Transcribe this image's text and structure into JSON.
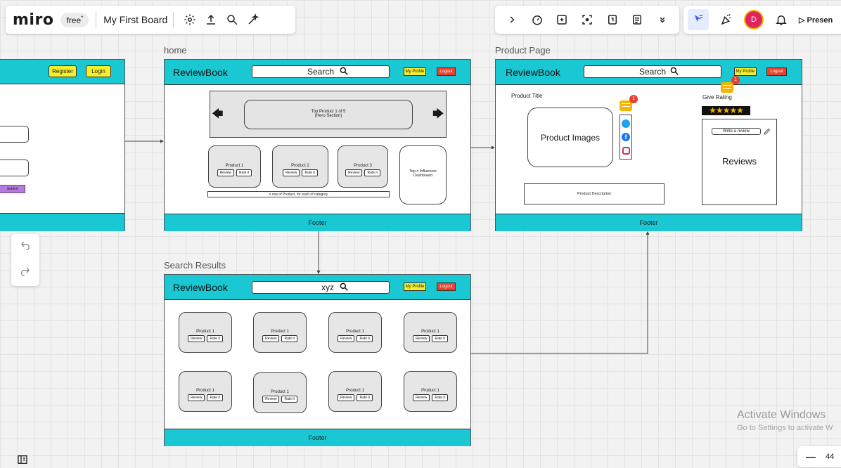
{
  "toolbar": {
    "logo": "miro",
    "plan_badge": "free",
    "plan_badge_mark": "*",
    "board_title": "My First Board",
    "present_label": "Presen",
    "user_initial": "D"
  },
  "colors": {
    "cyan": "#19c8d2",
    "yellow": "#f5ee2c",
    "red": "#e8412c",
    "accent": "#4262ff",
    "avatar": "#e0245e"
  },
  "login_frame": {
    "register_label": "Register",
    "login_label": "Login",
    "submit_label": "Submit"
  },
  "home": {
    "frame_label": "home",
    "brand": "ReviewBook",
    "search": "Search",
    "my_profile": "My Profile",
    "logout": "Logout",
    "hero_line1": "Top Product 1 of 5",
    "hero_line2": "(Hero Section)",
    "products": [
      {
        "title": "Product 1",
        "review": "Review",
        "rate": "Rate it"
      },
      {
        "title": "Product 2",
        "review": "Review",
        "rate": "Rate it"
      },
      {
        "title": "Product 3",
        "review": "Review",
        "rate": "Rate it"
      }
    ],
    "influencer_line1": "Top n Influencer",
    "influencer_line2": "Dashboard",
    "row_caption": "n row of Product, for each of category",
    "footer": "Footer"
  },
  "product_page": {
    "frame_label": "Product Page",
    "brand": "ReviewBook",
    "search": "Search",
    "my_profile": "My Profile",
    "logout": "Logout",
    "product_title": "Product Title",
    "product_images": "Product Images",
    "give_rating": "Give Rating",
    "write_review": "Write a review",
    "reviews": "Reviews",
    "product_description": "Product Description",
    "comment_count_1": "1",
    "comment_count_2": "1",
    "rating": 5,
    "footer": "Footer"
  },
  "search_results": {
    "frame_label": "Search Results",
    "brand": "ReviewBook",
    "search_value": "xyz",
    "my_profile": "My Profile",
    "logout": "Logout",
    "products": [
      {
        "title": "Product 1",
        "review": "Review",
        "rate": "Rate it"
      },
      {
        "title": "Product 1",
        "review": "Review",
        "rate": "Rate it"
      },
      {
        "title": "Product 1",
        "review": "Review",
        "rate": "Rate it"
      },
      {
        "title": "Product 1",
        "review": "Review",
        "rate": "Rate it"
      },
      {
        "title": "Product 1",
        "review": "Review",
        "rate": "Rate it"
      },
      {
        "title": "Product 1",
        "review": "Review",
        "rate": "Rate it"
      },
      {
        "title": "Product 1",
        "review": "Review",
        "rate": "Rate it"
      },
      {
        "title": "Product 1",
        "review": "Review",
        "rate": "Rate it"
      }
    ],
    "footer": "Footer"
  },
  "watermark": {
    "title": "Activate Windows",
    "subtitle": "Go to Settings to activate W"
  },
  "zoom": {
    "minus": "—",
    "value": "44"
  }
}
